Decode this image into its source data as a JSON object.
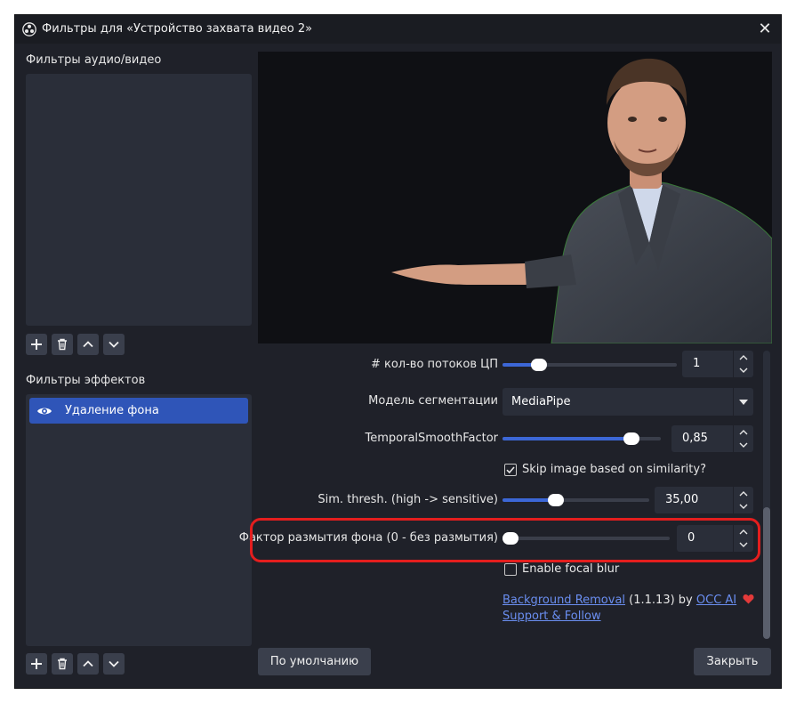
{
  "window": {
    "title": "Фильтры для «Устройство захвата видео 2»"
  },
  "audio_video": {
    "label": "Фильтры аудио/видео"
  },
  "effects": {
    "label": "Фильтры эффектов",
    "items": [
      {
        "label": "Удаление фона"
      }
    ]
  },
  "properties": {
    "threads": {
      "label": "# кол-во потоков ЦП",
      "value": "1",
      "level": 0.18
    },
    "model": {
      "label": "Модель сегментации",
      "value": "MediaPipe"
    },
    "temporal": {
      "label": "TemporalSmoothFactor",
      "value": "0,85",
      "level": 0.85
    },
    "skip": {
      "label": "Skip image based on similarity?",
      "checked": true
    },
    "sim": {
      "label": "Sim. thresh. (high -> sensitive)",
      "value": "35,00",
      "level": 0.35
    },
    "blur": {
      "label": "Фактор размытия фона (0 - без размытия)",
      "value": "0",
      "level": 0.0
    },
    "focal": {
      "label": "Enable focal blur",
      "checked": false
    },
    "credits": {
      "plugin": "Background Removal",
      "version": "(1.1.13) by",
      "author": "OCC AI",
      "support": "Support & Follow"
    }
  },
  "buttons": {
    "defaults": "По умолчанию",
    "close": "Закрыть"
  },
  "colors": {
    "accent": "#3c67d6",
    "selection": "#2f55b8",
    "highlight": "#e41e1e",
    "link": "#6a8ef0"
  }
}
